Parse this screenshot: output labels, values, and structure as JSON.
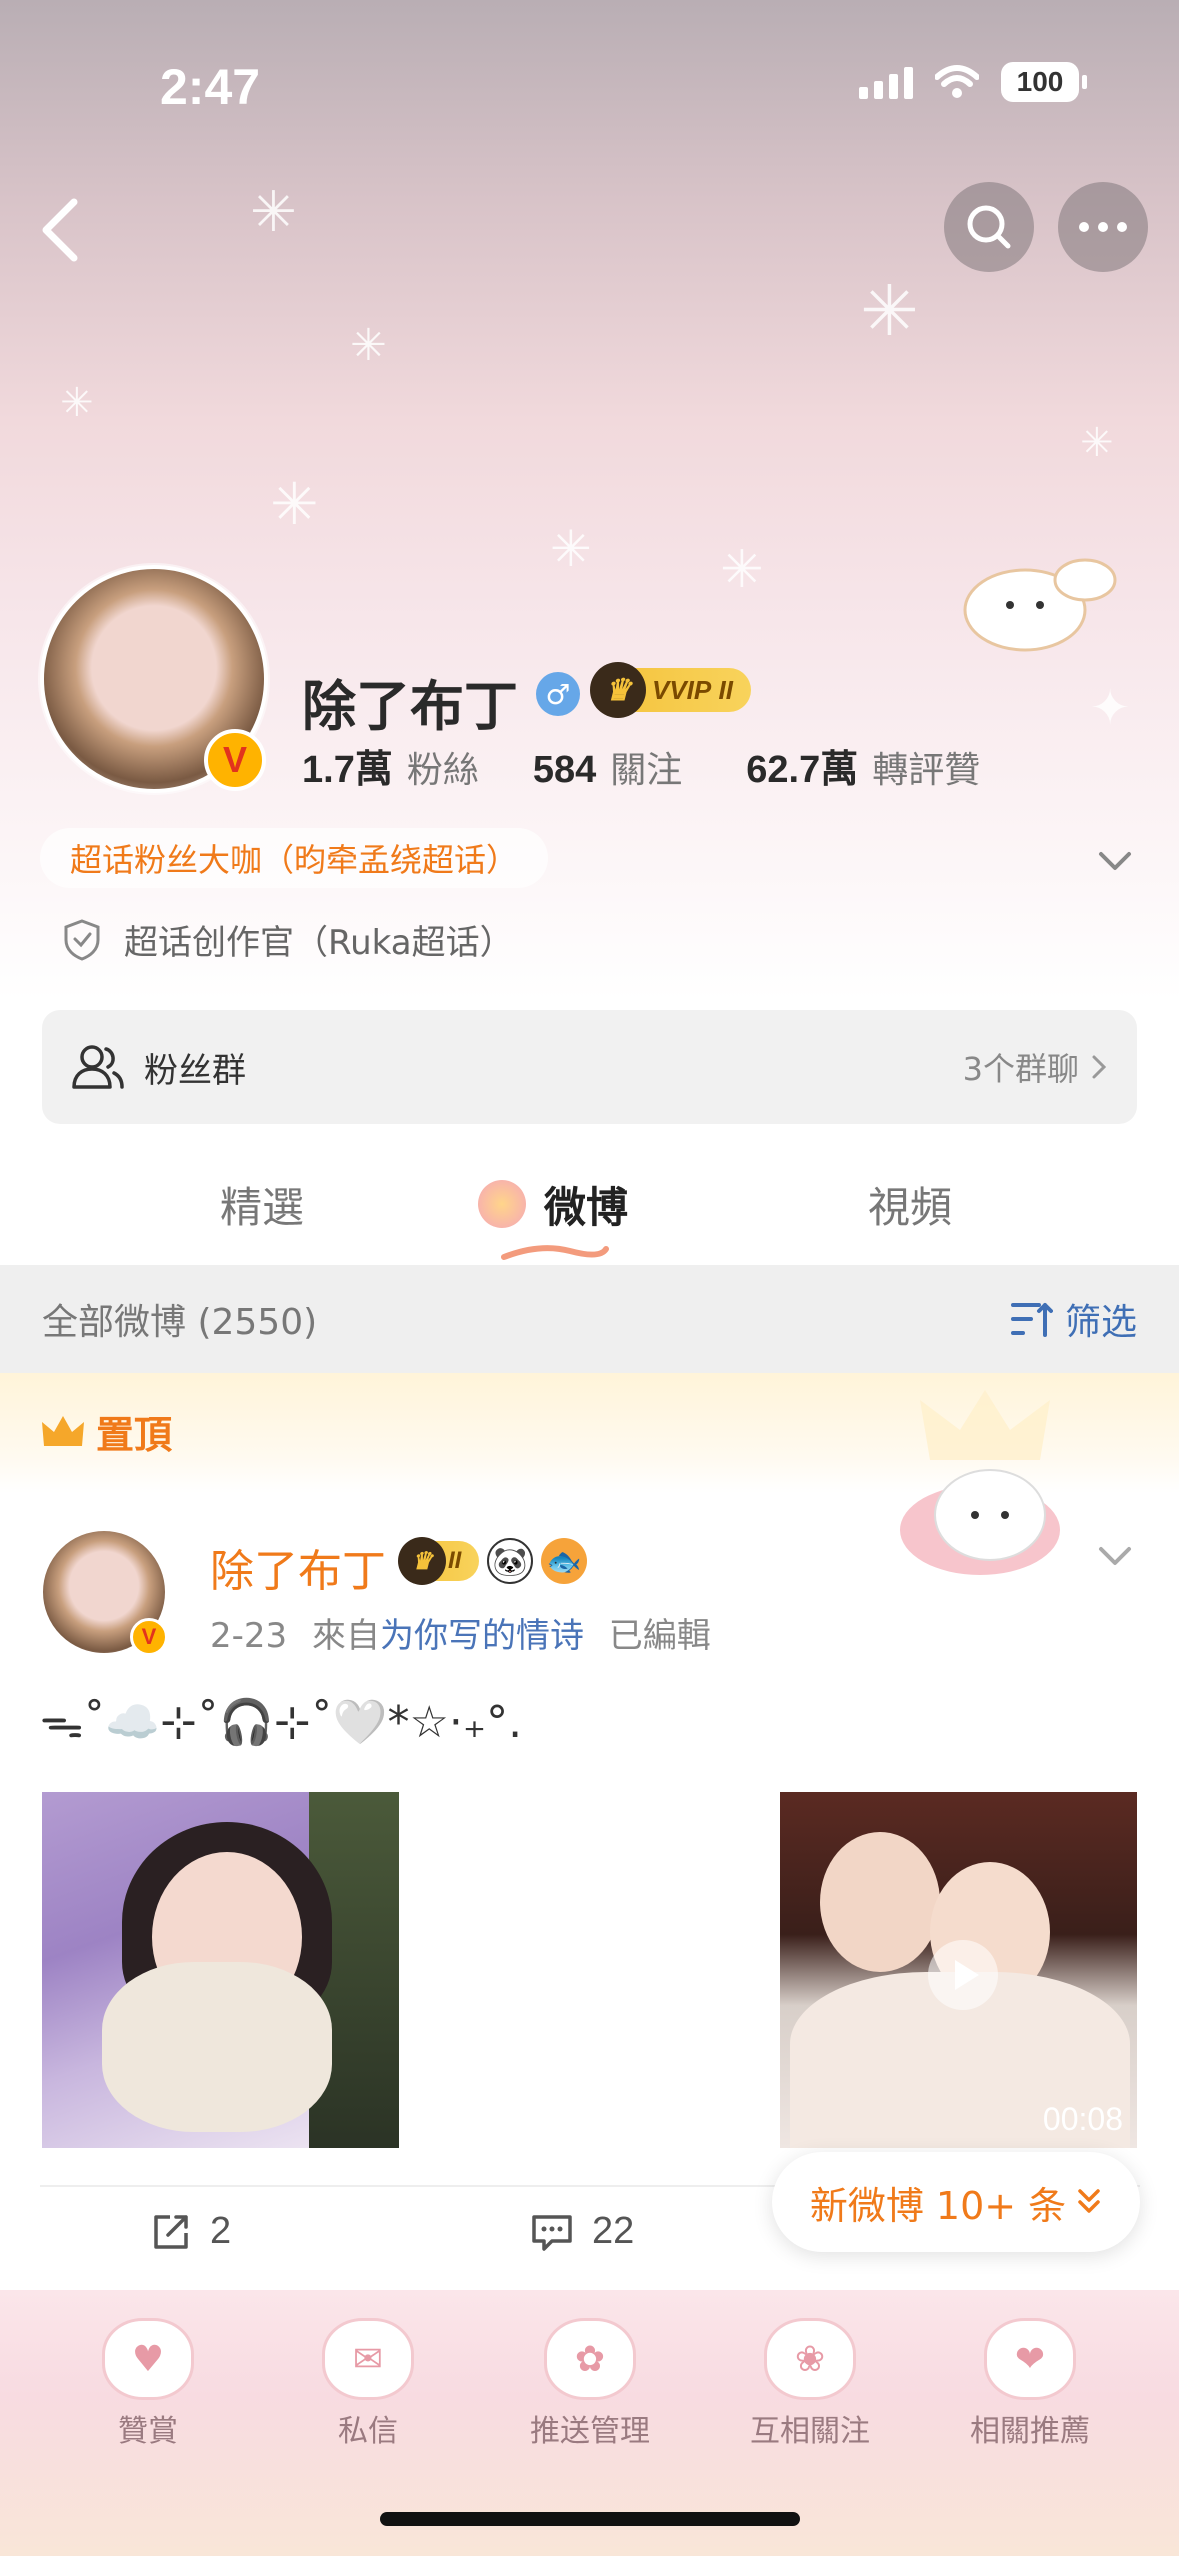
{
  "status_bar": {
    "time": "2:47",
    "battery": "100"
  },
  "profile": {
    "name": "除了布丁",
    "vip_badge": "VVIP",
    "vip_level": "II",
    "verified_mark": "V",
    "stats": [
      {
        "value": "1.7萬",
        "label": "粉絲"
      },
      {
        "value": "584",
        "label": "關注"
      },
      {
        "value": "62.7萬",
        "label": "轉評贊"
      }
    ],
    "supertopic_chip": "超话粉丝大咖（昀牵孟绕超话）",
    "creator_title": "超话创作官（Ruka超话）",
    "fan_group": {
      "label": "粉丝群",
      "count": "3个群聊"
    }
  },
  "tabs": [
    {
      "label": "精選"
    },
    {
      "label": "微博"
    },
    {
      "label": "視頻"
    }
  ],
  "feed": {
    "count_label": "全部微博 (2550)",
    "filter_label": "筛选",
    "pinned_label": "置頂"
  },
  "post": {
    "author": "除了布丁",
    "vip_level": "II",
    "date": "2-23",
    "source_prefix": "來自",
    "source": "为你写的情诗",
    "edited": "已編輯",
    "text": "ᯓ˚☁️⊹˚🎧⊹˚🤍*☆·₊°.",
    "video_duration": "00:08",
    "actions": [
      {
        "icon": "share-icon",
        "count": "2"
      },
      {
        "icon": "comment-icon",
        "count": "22"
      }
    ]
  },
  "new_posts_pill": "新微博 10+ 条",
  "bottom_nav": [
    {
      "label": "贊賞"
    },
    {
      "label": "私信"
    },
    {
      "label": "推送管理"
    },
    {
      "label": "互相關注"
    },
    {
      "label": "相關推薦"
    }
  ]
}
